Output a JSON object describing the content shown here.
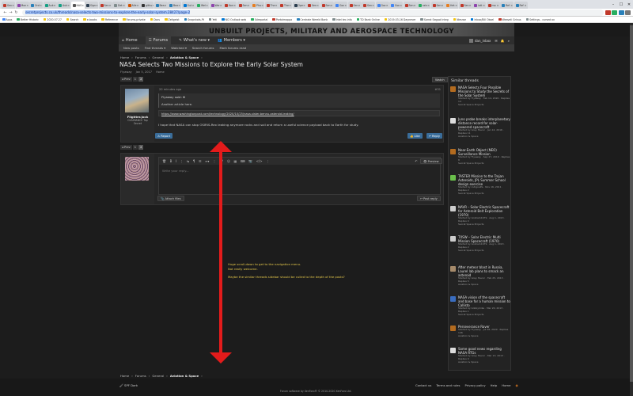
{
  "browser": {
    "tabs": [
      {
        "label": "Sen",
        "color": "#c0392b"
      },
      {
        "label": "Mon",
        "color": "#8e44ad"
      },
      {
        "label": "Ord",
        "color": "#2980b9"
      },
      {
        "label": "Auk",
        "color": "#16a085"
      },
      {
        "label": "Auk",
        "color": "#16a085"
      },
      {
        "label": "NAS",
        "color": "#555555",
        "active": true
      },
      {
        "label": "Sign",
        "color": "#2c3e50"
      },
      {
        "label": "Sen",
        "color": "#c0392b"
      },
      {
        "label": "Det",
        "color": "#7f8c8d"
      },
      {
        "label": "Alle",
        "color": "#d35400"
      },
      {
        "label": "githu",
        "color": "#333333"
      },
      {
        "label": "Bea",
        "color": "#2980b9"
      },
      {
        "label": "Bea",
        "color": "#2980b9"
      },
      {
        "label": "Out",
        "color": "#0078d4"
      },
      {
        "label": "Wel",
        "color": "#27ae60"
      },
      {
        "label": "Wer",
        "color": "#8e44ad"
      },
      {
        "label": "Kon",
        "color": "#c0392b"
      },
      {
        "label": "Sen",
        "color": "#c0392b"
      },
      {
        "label": "Pho",
        "color": "#e67e22"
      },
      {
        "label": "The",
        "color": "#c0392b"
      },
      {
        "label": "The",
        "color": "#c0392b"
      },
      {
        "label": "Ope",
        "color": "#2c3e50"
      },
      {
        "label": "Sen",
        "color": "#c0392b"
      },
      {
        "label": "Sen",
        "color": "#c0392b"
      },
      {
        "label": "Goc",
        "color": "#4285f4"
      },
      {
        "label": "Sen",
        "color": "#c0392b"
      },
      {
        "label": "Sen",
        "color": "#c0392b"
      },
      {
        "label": "Goc",
        "color": "#4285f4"
      },
      {
        "label": "Goc",
        "color": "#4285f4"
      },
      {
        "label": "Sen",
        "color": "#c0392b"
      },
      {
        "label": "rain",
        "color": "#27ae60"
      },
      {
        "label": "Sen",
        "color": "#c0392b"
      },
      {
        "label": "Het",
        "color": "#e67e22"
      },
      {
        "label": "Sen",
        "color": "#c0392b"
      },
      {
        "label": "lott",
        "color": "#8e44ad"
      },
      {
        "label": "mo",
        "color": "#c0392b"
      },
      {
        "label": "Ref",
        "color": "#2980b9"
      },
      {
        "label": "Ref",
        "color": "#2980b9"
      }
    ],
    "url_selected": "secretprojects.co.uk/threads/nasa-selects-two-missions-to-explore-the-early-solar-system.28427/page-2",
    "bookmarks": [
      {
        "label": "Apps",
        "color": "#4285f4"
      },
      {
        "label": "Better Historic",
        "color": "#27ae60"
      },
      {
        "label": "2020-07-27",
        "color": "#f1c40f"
      },
      {
        "label": "Search",
        "color": "#f1c40f"
      },
      {
        "label": "e-books",
        "color": "#f1c40f"
      },
      {
        "label": "Reference",
        "color": "#f1c40f"
      },
      {
        "label": "Forums-private",
        "color": "#f1c40f"
      },
      {
        "label": "Docs",
        "color": "#f1c40f"
      },
      {
        "label": "Zeitgeist",
        "color": "#f1c40f"
      },
      {
        "label": "Snapshots-Pt",
        "color": "#2980b9"
      },
      {
        "label": "Yeti",
        "color": "#7f8c8d"
      },
      {
        "label": "NCI Outlook web",
        "color": "#0078d4"
      },
      {
        "label": "Sdreportal",
        "color": "#27ae60"
      },
      {
        "label": "Portalmappa",
        "color": "#c0392b"
      },
      {
        "label": "Centrale Wereld Bank",
        "color": "#2980b9"
      },
      {
        "label": "intel tec.info",
        "color": "#7f8c8d"
      },
      {
        "label": "TD Bank Online",
        "color": "#27ae60"
      },
      {
        "label": "2019-03-16 Daynever",
        "color": "#f1c40f"
      },
      {
        "label": "Sorrot Segpol Integ",
        "color": "#7f8c8d"
      },
      {
        "label": "Nieuwe",
        "color": "#f1c40f"
      },
      {
        "label": "Inbox/Bill Okoel",
        "color": "#0078d4"
      },
      {
        "label": "Weaveli Grinus",
        "color": "#c0392b"
      },
      {
        "label": "Settings - cursed ax",
        "color": "#7f8c8d"
      }
    ],
    "win_min": "–",
    "win_max": "☐",
    "win_close": "✕",
    "back": "←",
    "forward": "→",
    "reload": "↻",
    "tab_close": "×"
  },
  "site": {
    "title": "UNBUILT PROJECTS, MILITARY AND AEROSPACE TECHNOLOGY",
    "nav": [
      {
        "icon": "⌂",
        "label": "Home"
      },
      {
        "icon": "☰",
        "label": "Forums",
        "active": true
      },
      {
        "icon": "✎",
        "label": "What's new ▾"
      },
      {
        "icon": "👥",
        "label": "Members ▾"
      }
    ],
    "user": "dan_inbox",
    "subnav": [
      "New posts",
      "Find threads ▾",
      "Watched ▾",
      "Search forums",
      "Mark forums read"
    ],
    "breadcrumb": [
      "Home",
      "Forums",
      "General",
      "Aviation & Space"
    ]
  },
  "thread": {
    "title": "NASA Selects Two Missions to Explore the Early Solar System",
    "author": "Flyaway",
    "date": "Jan 5, 2017",
    "tag": "Home",
    "prev": "◂ Prev",
    "page1": "1",
    "page2": "2",
    "watch": "Watch"
  },
  "post": {
    "time": "20 minutes ago",
    "number": "#31",
    "username": "Flighter.Jock",
    "usertitle": "CLEARANCE Top Secret",
    "quote_header": "Flyaway said: ⊕",
    "quote_text": "Another article here.",
    "link": "https://www.washingtonpost.com/technology/2020/10/25/nasa-sister-bennu-asteroid-leaking/",
    "body": "I hope that NASA can stop OSIRIS-Rex leaking anymore rocks and soil and return a useful science payload back to Earth for study.",
    "report": "Report",
    "like": "Like",
    "reply": "Reply"
  },
  "editor": {
    "placeholder": "Write your reply...",
    "preview": "Preview",
    "attach": "Attach files",
    "post_reply": "Post reply",
    "toolbar_left": [
      "🗑",
      "B",
      "I",
      "⋮",
      "⇆",
      "¶",
      "☰",
      "≡▾",
      "⋮",
      "🔗",
      "☺",
      "▦",
      "⌨",
      "📷",
      "</>",
      "⋮"
    ],
    "toolbar_right": [
      "↶",
      "↷",
      "⊞",
      "⚙"
    ]
  },
  "sidebar": {
    "title": "Similar threads",
    "items": [
      {
        "title": "NASA Selects Four Possible Missions to Study the Secrets of the Solar System",
        "meta": "Started by Flyaway · Feb 14, 2020 · Replies 14",
        "forum": "Secret Space Projects",
        "color": "#b36b1f"
      },
      {
        "title": "Juno probe breaks interplanetary distance record for solar-powered spacecraft",
        "meta": "Started by Grey Havoc · Jan 14, 2016 · Replies 11",
        "forum": "Aviation & Space",
        "color": "#dddddd"
      },
      {
        "title": "Near-Earth Object (NEO) Surveillance Mission",
        "meta": "Started by Flyaway · Sep 27, 2019 · Replies 8",
        "forum": "Secret Space Projects",
        "color": "#b36b1f"
      },
      {
        "title": "TASTER Mission to the Trojan Asteroids, JPL Summer School design exercise",
        "meta": "Started by indigoalfa · Nov 16, 2011 · Replies 2",
        "forum": "Secret Space Projects",
        "color": "#6abf4b"
      },
      {
        "title": "NAVR – Solar Electric Spacecraft for Asteroid Belt Exploration (1970)",
        "meta": "Started by Graham1979 · Aug 1, 2013 · Replies 0",
        "forum": "Secret Space Projects",
        "color": "#cccccc"
      },
      {
        "title": "TXSW – Solar Electric Multi Mission Spacecraft (1970)",
        "meta": "Started by Graham1979 · Aug 1, 2013 · Replies 2",
        "forum": "Secret Space Projects",
        "color": "#cccccc"
      },
      {
        "title": "After meteor blast in Russia, Laurel lab plans to smack an asteroid",
        "meta": "Started by Grey Havoc · Feb 25, 2013 · Replies 5",
        "forum": "Aviation & Space",
        "color": "#a68b6b"
      },
      {
        "title": "NASA vision of the spacecraft and base for a human mission to Callisto",
        "meta": "Started by bobbymike · Mar 20, 2013 · Replies 1",
        "forum": "Secret Space Projects",
        "color": "#3a6dbf"
      },
      {
        "title": "Perseverance Rover",
        "meta": "Started by Flyaway · Jul 28, 2020 · Replies 146",
        "forum": "Aviation & Space",
        "color": "#b36b1f"
      },
      {
        "title": "Some good news regarding NASA RTGs",
        "meta": "Started by Grey Havoc · Mar 13, 2013 · Replies 0",
        "forum": "Aviation & Space",
        "color": "#dddddd"
      }
    ]
  },
  "annotation": {
    "line1": "Huge scroll-down to get to the navigation menu.",
    "line2": "Not really welcome.",
    "line3": "Maybe the similar threads sidebar should be culled to the depth of the posts?"
  },
  "footer": {
    "style": "SPF Dark",
    "links": [
      "Contact us",
      "Terms and rules",
      "Privacy policy",
      "Help",
      "Home"
    ],
    "credit": "Forum software by XenForo® © 2010-2020 XenForo Ltd."
  },
  "colors": {
    "accent_blue": "#3a6d9a",
    "annotation": "#e6c94a",
    "arrow": "#e31b1b"
  }
}
